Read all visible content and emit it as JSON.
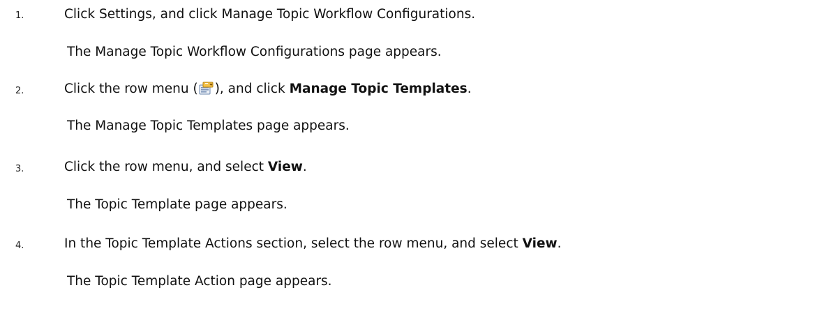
{
  "steps": [
    {
      "number": "1.",
      "instruction": "Click Settings, and click Manage Topic Workflow Configurations.",
      "result": "The Manage Topic Workflow Configurations page appears."
    },
    {
      "number": "2.",
      "instruction_prefix": "Click the row menu (",
      "icon": "row-menu-icon",
      "instruction_middle": "), and click ",
      "instruction_bold": "Manage Topic Templates",
      "instruction_suffix": ".",
      "result": "The Manage Topic Templates page appears."
    },
    {
      "number": "3.",
      "instruction_prefix": "Click the row menu, and select ",
      "instruction_bold": "View",
      "instruction_suffix": ".",
      "result": "The Topic Template page appears."
    },
    {
      "number": "4.",
      "instruction_prefix": "In the Topic Template Actions section, select the row menu, and select ",
      "instruction_bold": "View",
      "instruction_suffix": ".",
      "result": "The Topic Template Action page appears."
    }
  ]
}
